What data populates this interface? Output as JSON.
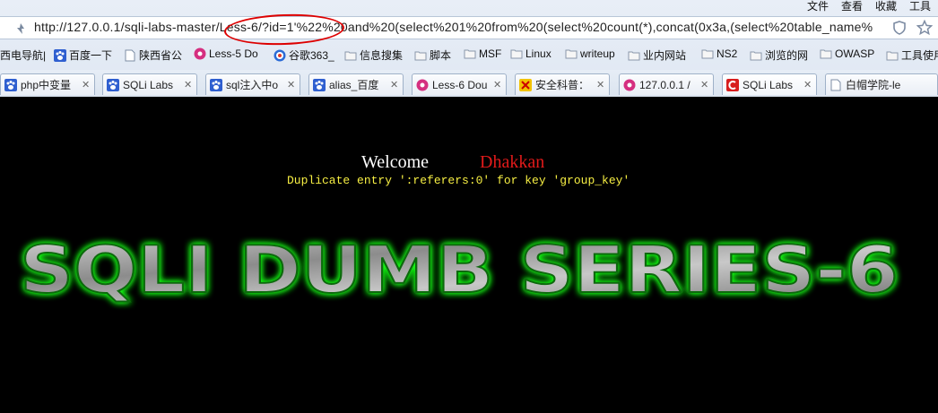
{
  "menu": [
    "文件",
    "查看",
    "收藏",
    "工具"
  ],
  "address": {
    "url": "http://127.0.0.1/sqli-labs-master/Less-6/?id=1'%22%20and%20(select%201%20from%20(select%20count(*),concat(0x3a,(select%20table_name%"
  },
  "bookmarks": [
    {
      "label": "西电导航|",
      "icon": "none"
    },
    {
      "label": "百度一下",
      "icon": "paw-icon"
    },
    {
      "label": "陕西省公",
      "icon": "page-icon"
    },
    {
      "label": "Less-5 Do",
      "icon": "pink-circle-icon"
    },
    {
      "label": "谷歌363_",
      "icon": "360-icon"
    },
    {
      "label": "信息搜集",
      "icon": "folder-icon"
    },
    {
      "label": "脚本",
      "icon": "folder-icon"
    },
    {
      "label": "MSF",
      "icon": "folder-icon"
    },
    {
      "label": "Linux",
      "icon": "folder-icon"
    },
    {
      "label": "writeup",
      "icon": "folder-icon"
    },
    {
      "label": "业内网站",
      "icon": "folder-icon"
    },
    {
      "label": "NS2",
      "icon": "folder-icon"
    },
    {
      "label": "浏览的网",
      "icon": "folder-icon"
    },
    {
      "label": "OWASP",
      "icon": "folder-icon"
    },
    {
      "label": "工具使用",
      "icon": "folder-icon"
    }
  ],
  "tabs": [
    {
      "label": "php中变量",
      "icon": "paw-icon"
    },
    {
      "label": "SQLi Labs",
      "icon": "paw-icon"
    },
    {
      "label": "sql注入中o",
      "icon": "paw-icon"
    },
    {
      "label": "alias_百度",
      "icon": "paw-icon"
    },
    {
      "label": "Less-6 Dou",
      "icon": "pink-circle-icon"
    },
    {
      "label": "安全科普：",
      "icon": "safe-icon"
    },
    {
      "label": "127.0.0.1 /",
      "icon": "pink-circle-icon"
    },
    {
      "label": "SQLi Labs",
      "icon": "red-c-icon"
    },
    {
      "label": "白帽学院-le",
      "icon": "page-icon"
    }
  ],
  "page": {
    "welcome": "Welcome",
    "name": "Dhakkan",
    "error": "Duplicate entry ':referers:0' for key 'group_key'",
    "banner": "SQLI DUMB SERIES-6"
  },
  "colors": {
    "background": "#000000",
    "name": "#e21a1a",
    "error": "#f7ef43",
    "banner_glow": "#19ff19"
  }
}
